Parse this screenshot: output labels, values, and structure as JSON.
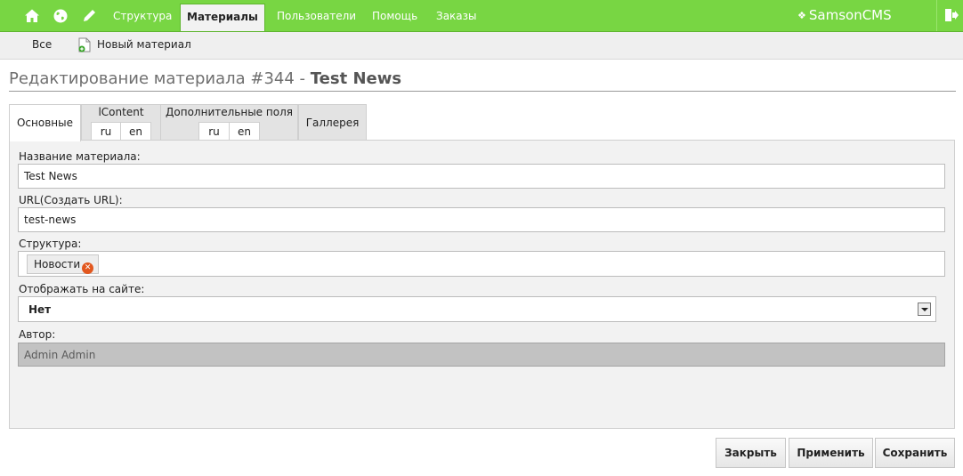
{
  "topnav": {
    "items": [
      {
        "label": "Структура"
      },
      {
        "label": "Материалы",
        "active": true
      },
      {
        "label": "Пользователи"
      },
      {
        "label": "Помощь"
      },
      {
        "label": "Заказы"
      }
    ],
    "brand": "SamsonCMS"
  },
  "subnav": {
    "all_label": "Все",
    "new_label": "Новый материал"
  },
  "page": {
    "title_prefix": "Редактирование материала #344 - ",
    "title_name": "Test News"
  },
  "tabs": [
    {
      "label": "Основные",
      "active": true
    },
    {
      "label": "lContent",
      "langs": [
        "ru",
        "en"
      ]
    },
    {
      "label": "Дополнительные поля",
      "langs": [
        "ru",
        "en"
      ]
    },
    {
      "label": "Галлерея"
    }
  ],
  "form": {
    "name_label": "Название материала:",
    "name_value": "Test News",
    "url_label": "URL(Создать URL):",
    "url_value": "test-news",
    "structure_label": "Структура:",
    "structure_chip": "Новости",
    "visible_label": "Отображать на сайте:",
    "visible_value": "Нет",
    "author_label": "Автор:",
    "author_value": "Admin Admin"
  },
  "buttons": {
    "close": "Закрыть",
    "apply": "Применить",
    "save": "Сохранить"
  },
  "colors": {
    "topbar": "#78d643",
    "panel": "#f2f2f2",
    "chip_remove": "#e2571e"
  },
  "icons": [
    "home-icon",
    "globe-icon",
    "pencil-icon",
    "paw-icon",
    "logout-icon",
    "new-document-icon",
    "remove-icon",
    "dropdown-arrow-icon"
  ]
}
